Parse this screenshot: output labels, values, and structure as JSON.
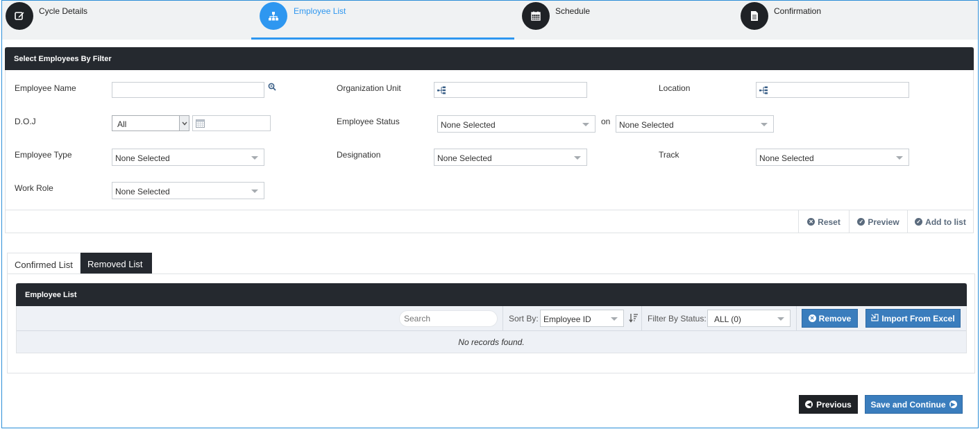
{
  "wizard": {
    "steps": [
      {
        "label": "Cycle Details",
        "icon": "edit-icon",
        "active": false
      },
      {
        "label": "Employee List",
        "icon": "sitemap-icon",
        "active": true
      },
      {
        "label": "Schedule",
        "icon": "calendar-icon",
        "active": false
      },
      {
        "label": "Confirmation",
        "icon": "document-icon",
        "active": false
      }
    ]
  },
  "filter": {
    "title": "Select Employees By Filter",
    "employee_name_label": "Employee Name",
    "employee_name_value": "",
    "org_unit_label": "Organization Unit",
    "location_label": "Location",
    "doj_label": "D.O.J",
    "doj_value": "All",
    "employee_status_label": "Employee Status",
    "employee_status_value": "None Selected",
    "on_label": "on",
    "on_value": "None Selected",
    "employee_type_label": "Employee Type",
    "employee_type_value": "None Selected",
    "designation_label": "Designation",
    "designation_value": "None Selected",
    "track_label": "Track",
    "track_value": "None Selected",
    "work_role_label": "Work Role",
    "work_role_value": "None Selected",
    "reset_label": "Reset",
    "preview_label": "Preview",
    "add_label": "Add to list"
  },
  "tabs": {
    "confirmed": "Confirmed List",
    "removed": "Removed List"
  },
  "list": {
    "title": "Employee List",
    "search_placeholder": "Search",
    "sort_label": "Sort By:",
    "sort_value": "Employee ID",
    "filter_status_label": "Filter By Status:",
    "filter_status_value": "ALL (0)",
    "remove_label": "Remove",
    "import_label": "Import From Excel",
    "empty_message": "No records found."
  },
  "nav": {
    "previous_label": "Previous",
    "save_label": "Save and Continue"
  },
  "colors": {
    "accent": "#2e97f0",
    "dark": "#25292f",
    "button_blue": "#3a7dbd"
  }
}
